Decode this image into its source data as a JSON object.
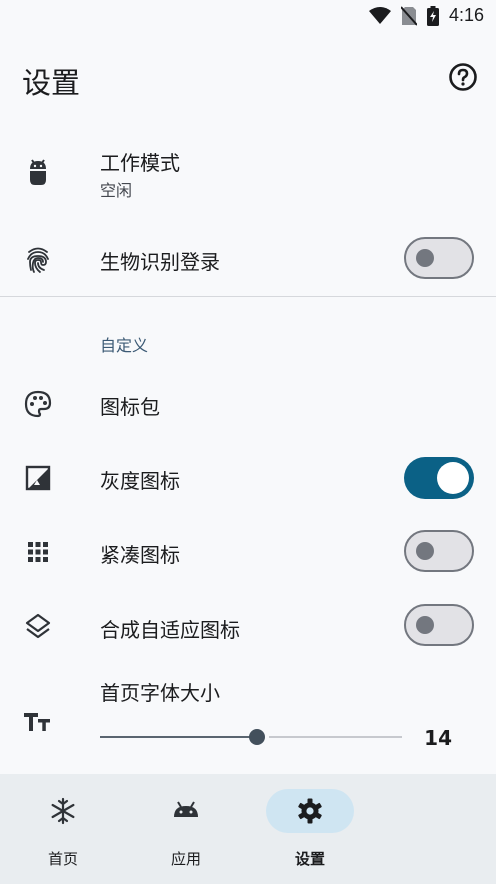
{
  "status": {
    "time": "4:16"
  },
  "header": {
    "title": "设置",
    "help_icon": "help-circle-icon"
  },
  "rows": {
    "work_mode": {
      "title": "工作模式",
      "subtitle": "空闲",
      "icon": "android-icon"
    },
    "biometric": {
      "title": "生物识别登录",
      "icon": "fingerprint-icon",
      "enabled": false
    },
    "custom_section": "自定义",
    "icon_pack": {
      "title": "图标包",
      "icon": "palette-icon"
    },
    "grayscale": {
      "title": "灰度图标",
      "icon": "grayscale-image-icon",
      "enabled": true
    },
    "compact": {
      "title": "紧凑图标",
      "icon": "grid-icon",
      "enabled": false
    },
    "adaptive": {
      "title": "合成自适应图标",
      "icon": "layers-icon",
      "enabled": false
    },
    "font_size": {
      "title": "首页字体大小",
      "icon": "text-size-icon",
      "value": "14",
      "min": 0,
      "max": 27,
      "current": 14
    }
  },
  "colors": {
    "accent": "#0b6186",
    "nav_active": "#cfe5f2",
    "background": "#f8f9fb"
  },
  "nav": [
    {
      "label": "首页",
      "icon": "snowflake-icon",
      "active": false
    },
    {
      "label": "应用",
      "icon": "android-icon",
      "active": false
    },
    {
      "label": "设置",
      "icon": "gear-icon",
      "active": true
    }
  ]
}
